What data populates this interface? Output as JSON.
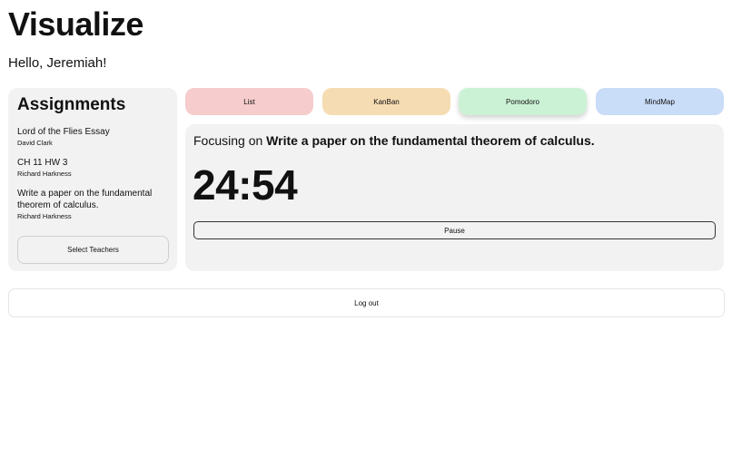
{
  "app": {
    "title": "Visualize",
    "greeting": "Hello, Jeremiah!"
  },
  "assignments": {
    "heading": "Assignments",
    "items": [
      {
        "title": "Lord of the Flies Essay",
        "teacher": "David Clark"
      },
      {
        "title": "CH 11 HW 3",
        "teacher": "Richard Harkness"
      },
      {
        "title": "Write a paper on the fundamental theorem of calculus.",
        "teacher": "Richard Harkness"
      }
    ],
    "select_teachers_label": "Select Teachers"
  },
  "views": {
    "active": "Pomodoro",
    "tabs": [
      {
        "label": "List",
        "color": "#f6cccc"
      },
      {
        "label": "KanBan",
        "color": "#f6dcb3"
      },
      {
        "label": "Pomodoro",
        "color": "#ccf2d6"
      },
      {
        "label": "MindMap",
        "color": "#c9dcf8"
      }
    ]
  },
  "focus": {
    "prefix": "Focusing on",
    "task": "Write a paper on the fundamental theorem of calculus.",
    "timer": "24:54",
    "pause_label": "Pause"
  },
  "logout_label": "Log out"
}
